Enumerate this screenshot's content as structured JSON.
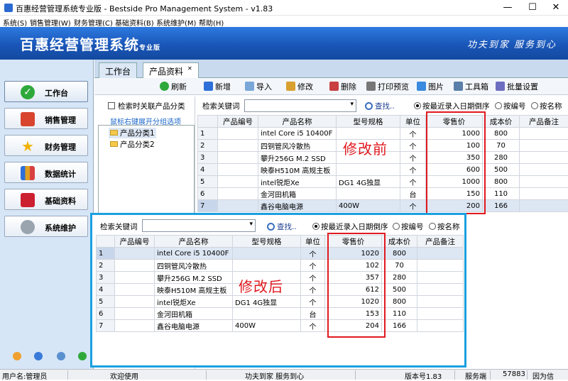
{
  "window": {
    "title": "百惠经营管理系统专业版 - Bestside Pro Management System - v1.83"
  },
  "menu": [
    "系统(S)",
    "销售管理(W)",
    "财务管理(C)",
    "基础资料(B)",
    "系统维护(M)",
    "帮助(H)"
  ],
  "banner": {
    "name": "百惠经营管理系统",
    "edition": "专业版",
    "slogan": "功夫到家 服务到心"
  },
  "nav": [
    "工作台",
    "销售管理",
    "财务管理",
    "数据统计",
    "基础资料",
    "系统维护"
  ],
  "tabs": [
    "工作台",
    "产品资料"
  ],
  "toolbar": {
    "refresh": "刷新",
    "add": "新增",
    "import": "导入",
    "edit": "修改",
    "delete": "删除",
    "print": "打印预览",
    "image": "图片",
    "toolbox": "工具箱",
    "batch": "批量设置"
  },
  "tree": {
    "search_related": "检索时关联产品分类",
    "hint": "鼠标右键展开分组选项",
    "cat1": "产品分类1",
    "cat2": "产品分类2"
  },
  "search": {
    "label": "检索关键词",
    "value": "",
    "find": "查找..",
    "order_recent": "按最近录入日期倒序",
    "order_code": "按编号",
    "order_name": "按名称"
  },
  "columns": [
    "产品编号",
    "产品名称",
    "型号规格",
    "单位",
    "零售价",
    "成本价",
    "产品备注"
  ],
  "rows_before": [
    {
      "i": "1",
      "code": "",
      "name": "intel Core i5 10400F",
      "spec": "",
      "unit": "个",
      "price": "1000",
      "cost": "800",
      "note": ""
    },
    {
      "i": "2",
      "code": "",
      "name": "四铜管风冷散热",
      "spec": "",
      "unit": "个",
      "price": "100",
      "cost": "70",
      "note": ""
    },
    {
      "i": "3",
      "code": "",
      "name": "攀升256G M.2 SSD",
      "spec": "",
      "unit": "个",
      "price": "350",
      "cost": "280",
      "note": ""
    },
    {
      "i": "4",
      "code": "",
      "name": "映泰H510M 高规主板",
      "spec": "",
      "unit": "个",
      "price": "600",
      "cost": "500",
      "note": ""
    },
    {
      "i": "5",
      "code": "",
      "name": "intel锐炬Xe",
      "spec": "DG1 4G独显",
      "unit": "个",
      "price": "1000",
      "cost": "800",
      "note": ""
    },
    {
      "i": "6",
      "code": "",
      "name": "金河田机箱",
      "spec": "",
      "unit": "台",
      "price": "150",
      "cost": "110",
      "note": ""
    },
    {
      "i": "7",
      "code": "",
      "name": "鑫谷电脑电源",
      "spec": "400W",
      "unit": "个",
      "price": "200",
      "cost": "166",
      "note": ""
    }
  ],
  "rows_after": [
    {
      "i": "1",
      "code": "",
      "name": "intel Core i5 10400F",
      "spec": "",
      "unit": "个",
      "price": "1020",
      "cost": "800",
      "note": ""
    },
    {
      "i": "2",
      "code": "",
      "name": "四铜管风冷散热",
      "spec": "",
      "unit": "个",
      "price": "102",
      "cost": "70",
      "note": ""
    },
    {
      "i": "3",
      "code": "",
      "name": "攀升256G M.2 SSD",
      "spec": "",
      "unit": "个",
      "price": "357",
      "cost": "280",
      "note": ""
    },
    {
      "i": "4",
      "code": "",
      "name": "映泰H510M 高规主板",
      "spec": "",
      "unit": "个",
      "price": "612",
      "cost": "500",
      "note": ""
    },
    {
      "i": "5",
      "code": "",
      "name": "intel锐炬Xe",
      "spec": "DG1 4G独显",
      "unit": "个",
      "price": "1020",
      "cost": "800",
      "note": ""
    },
    {
      "i": "6",
      "code": "",
      "name": "金河田机箱",
      "spec": "",
      "unit": "台",
      "price": "153",
      "cost": "110",
      "note": ""
    },
    {
      "i": "7",
      "code": "",
      "name": "鑫谷电脑电源",
      "spec": "400W",
      "unit": "个",
      "price": "204",
      "cost": "166",
      "note": ""
    }
  ],
  "annotations": {
    "before": "修改前",
    "after": "修改后"
  },
  "status": {
    "user": "用户名:管理员",
    "welcome": "欢迎使用",
    "slogan": "功夫到家 服务到心",
    "version": "版本号1.83",
    "server": "服务端",
    "port": "57883",
    "tail": "因为信"
  },
  "colors": {
    "accent_red": "#e0191f",
    "overlay_blue": "#1aa0e0",
    "banner_blue": "#1a56b8"
  }
}
